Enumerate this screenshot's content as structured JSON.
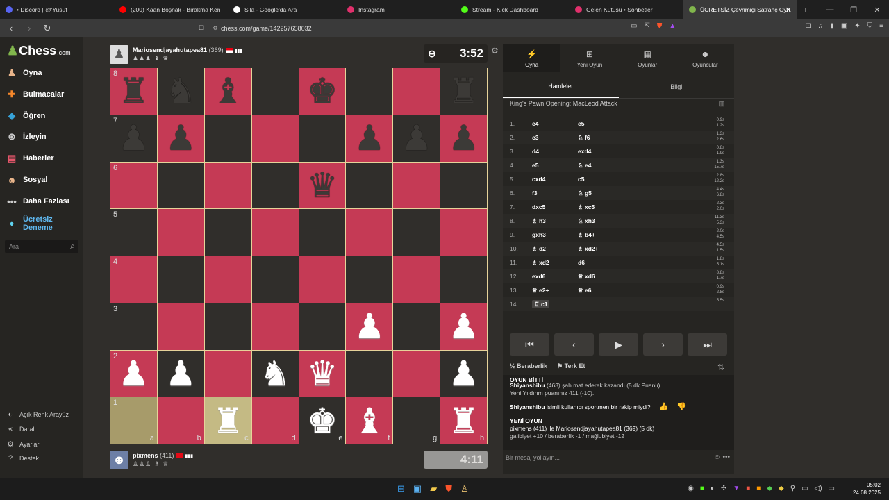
{
  "browser": {
    "tabs": [
      {
        "label": "• Discord | @'Yusuf",
        "color": "#5865f2"
      },
      {
        "label": "(200) Kaan Boşnak - Bırakma Ken",
        "color": "#ff0000"
      },
      {
        "label": "Sila - Google'da Ara",
        "color": "#ffffff"
      },
      {
        "label": "Instagram",
        "color": "#e1306c"
      },
      {
        "label": "Stream - Kick Dashboard",
        "color": "#53fc18"
      },
      {
        "label": "Gelen Kutusu • Sohbetler",
        "color": "#e1306c"
      },
      {
        "label": "ÜCRETSİZ Çevrimiçi Satranç Oyn",
        "color": "#81b64c"
      }
    ],
    "url": "chess.com/game/142257658032"
  },
  "sidebar": {
    "logo": "Chess",
    "logo_suffix": ".com",
    "items": [
      {
        "label": "Oyna",
        "icon": "play-icon"
      },
      {
        "label": "Bulmacalar",
        "icon": "puzzle-icon"
      },
      {
        "label": "Öğren",
        "icon": "learn-icon"
      },
      {
        "label": "İzleyin",
        "icon": "binoculars-icon"
      },
      {
        "label": "Haberler",
        "icon": "news-icon"
      },
      {
        "label": "Sosyal",
        "icon": "social-icon"
      },
      {
        "label": "Daha Fazlası",
        "icon": "more-icon"
      }
    ],
    "trial": "Ücretsiz Deneme",
    "search_placeholder": "Ara",
    "bottom": [
      "Açık Renk Arayüz",
      "Daralt",
      "Ayarlar",
      "Destek"
    ]
  },
  "top_player": {
    "name": "Mariosendjayahutapea81",
    "rating": "(369)",
    "caps": "♟♟♟ ♝ ♛",
    "clock": "3:52"
  },
  "bottom_player": {
    "name": "pixmens",
    "rating": "(411)",
    "caps": "♙♙♙ ♗ ♕",
    "clock": "4:11"
  },
  "board": {
    "ranks": [
      "8",
      "7",
      "6",
      "5",
      "4",
      "3",
      "2",
      "1"
    ],
    "files": [
      "a",
      "b",
      "c",
      "d",
      "e",
      "f",
      "g",
      "h"
    ],
    "rows": [
      [
        "bR",
        "bN",
        "bB",
        "",
        "bK",
        "",
        "",
        "bR"
      ],
      [
        "bP",
        "bP",
        "",
        "",
        "",
        "bP",
        "bP",
        "bP"
      ],
      [
        "",
        "",
        "",
        "",
        "bQ",
        "",
        "",
        ""
      ],
      [
        "",
        "",
        "",
        "",
        "",
        "",
        "",
        ""
      ],
      [
        "",
        "",
        "",
        "",
        "",
        "",
        "",
        ""
      ],
      [
        "",
        "",
        "",
        "",
        "",
        "wP",
        "",
        "wP"
      ],
      [
        "wP",
        "wP",
        "",
        "wN",
        "wQ",
        "",
        "",
        "wP"
      ],
      [
        "",
        "",
        "wR",
        "",
        "wK",
        "wB",
        "",
        "wR"
      ]
    ]
  },
  "panel": {
    "tabs": [
      {
        "label": "Oyna",
        "icon": "lightning-icon"
      },
      {
        "label": "Yeni Oyun",
        "icon": "plus-icon"
      },
      {
        "label": "Oyunlar",
        "icon": "board-icon"
      },
      {
        "label": "Oyuncular",
        "icon": "players-icon"
      }
    ],
    "subtabs": [
      "Hamleler",
      "Bilgi"
    ],
    "opening": "King's Pawn Opening: MacLeod Attack",
    "moves": [
      {
        "n": "1.",
        "w": "e4",
        "b": "e5",
        "t1": "0.9s",
        "t2": "1.2s"
      },
      {
        "n": "2.",
        "w": "c3",
        "b": "♘ f6",
        "t1": "1.3s",
        "t2": "2.6s"
      },
      {
        "n": "3.",
        "w": "d4",
        "b": "exd4",
        "t1": "0.8s",
        "t2": "1.9s"
      },
      {
        "n": "4.",
        "w": "e5",
        "b": "♘ e4",
        "t1": "1.3s",
        "t2": "15.7s"
      },
      {
        "n": "5.",
        "w": "cxd4",
        "b": "c5",
        "t1": "2.8s",
        "t2": "12.2s"
      },
      {
        "n": "6.",
        "w": "f3",
        "b": "♘ g5",
        "t1": "4.4s",
        "t2": "6.8s"
      },
      {
        "n": "7.",
        "w": "dxc5",
        "b": "♗ xc5",
        "t1": "2.3s",
        "t2": "2.0s"
      },
      {
        "n": "8.",
        "w": "♗ h3",
        "b": "♘ xh3",
        "t1": "11.3s",
        "t2": "5.3s"
      },
      {
        "n": "9.",
        "w": "gxh3",
        "b": "♗ b4+",
        "t1": "2.0s",
        "t2": "4.5s"
      },
      {
        "n": "10.",
        "w": "♗ d2",
        "b": "♗ xd2+",
        "t1": "4.5s",
        "t2": "1.5s"
      },
      {
        "n": "11.",
        "w": "♗ xd2",
        "b": "d6",
        "t1": "1.8s",
        "t2": "5.1s"
      },
      {
        "n": "12.",
        "w": "exd6",
        "b": "♕ xd6",
        "t1": "8.8s",
        "t2": "1.7s"
      },
      {
        "n": "13.",
        "w": "♕ e2+",
        "b": "♕ e6",
        "t1": "0.9s",
        "t2": "2.8s"
      },
      {
        "n": "14.",
        "w": "♖ c1",
        "b": "",
        "t1": "5.5s",
        "t2": ""
      }
    ],
    "draw": "Beraberlik",
    "resign": "Terk Et",
    "chat": {
      "over": "OYUN BİTTİ",
      "line1_name": "Shiyanshibu",
      "line1": "(463) şah mat ederek kazandı (5 dk Puanlı)",
      "line2": "Yeni Yıldırım puanınız 411 (-10).",
      "question_name": "Shiyanshibu",
      "question": "isimli kullanıcı sportmen bir rakip miydi?",
      "newgame": "YENİ OYUN",
      "ng_line": "pixmens (411) ile Mariosendjayahutapea81 (369) (5 dk)",
      "ng_stats": "galibiyet +10 / beraberlik -1 / mağlubiyet -12"
    },
    "message_placeholder": "Bir mesaj yollayın..."
  },
  "taskbar": {
    "time": "05:02",
    "date": "24.08.2025"
  }
}
